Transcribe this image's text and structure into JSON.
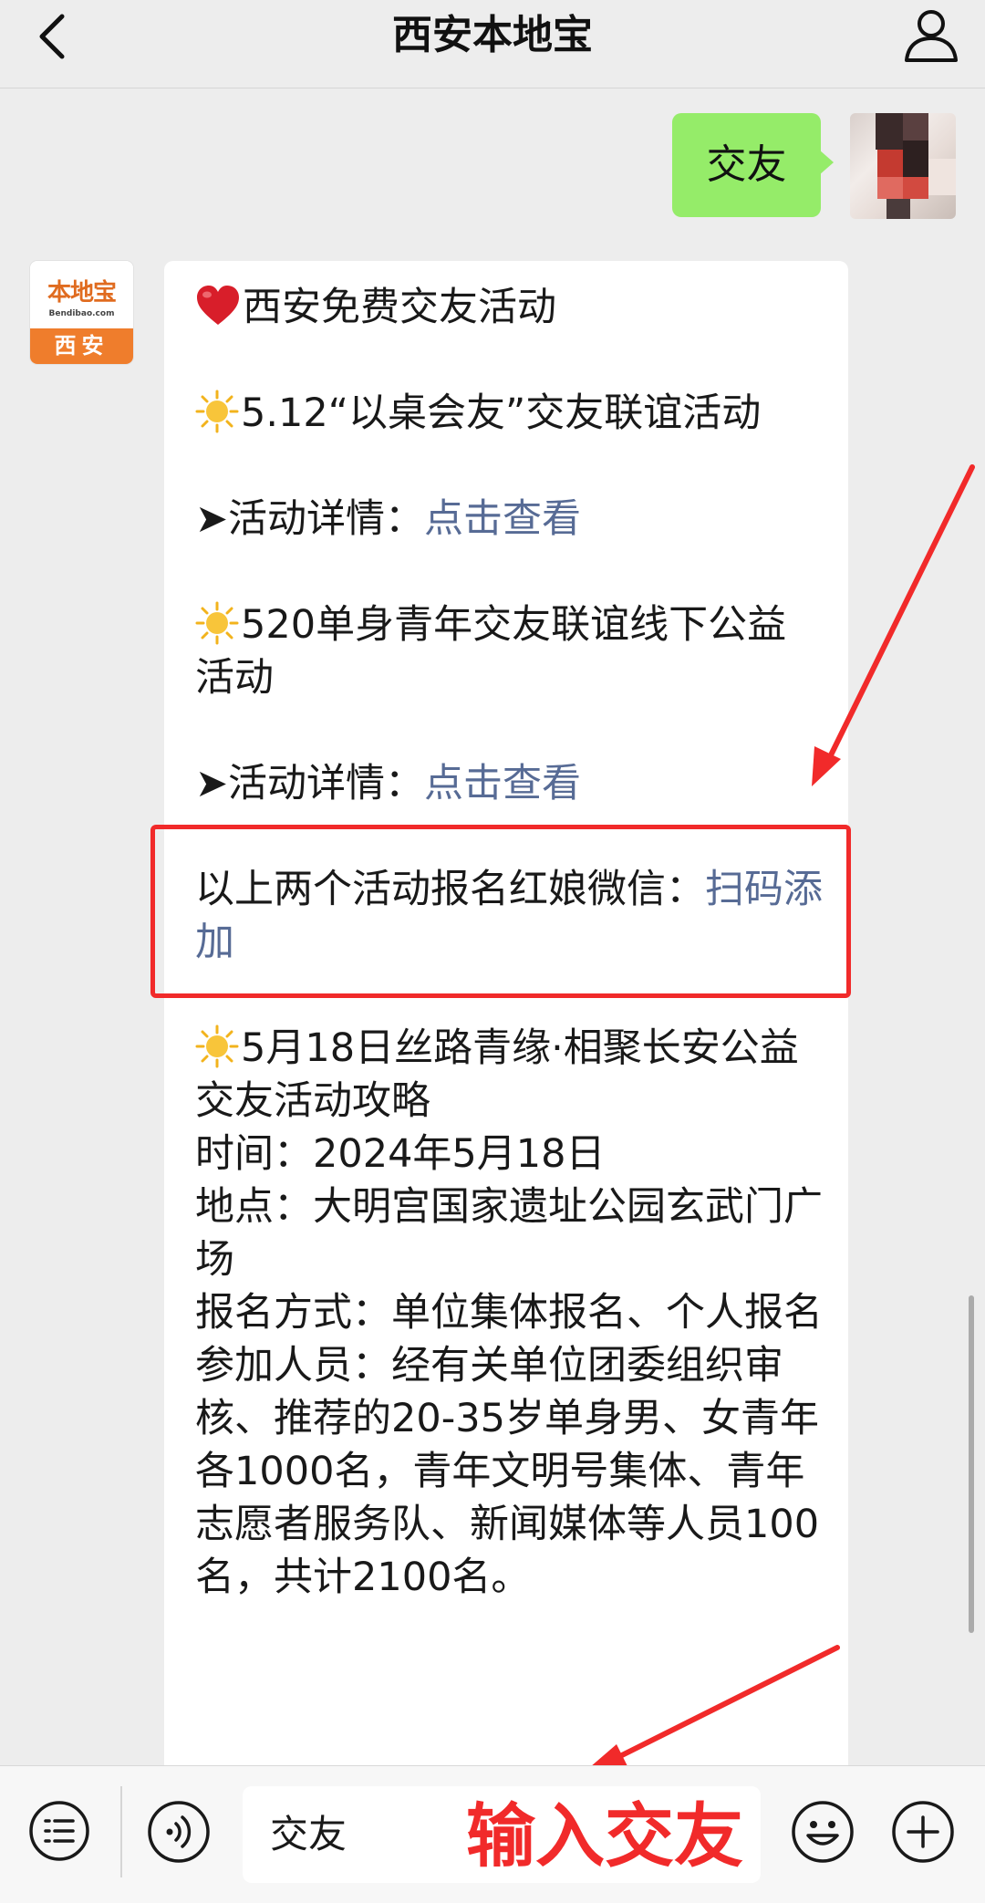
{
  "header": {
    "title": "西安本地宝"
  },
  "user_message": {
    "text": "交友"
  },
  "bot": {
    "avatar_logo": "本地宝",
    "avatar_domain": "Bendibao.com",
    "avatar_city": "西安"
  },
  "message": {
    "heading": "西安免费交友活动",
    "event1_title": "5.12“以桌会友”交友联谊活动",
    "event1_detail_label": "➤活动详情：",
    "event1_detail_link": "点击查看",
    "event2_title": "520单身青年交友联谊线下公益活动",
    "event2_detail_label": "➤活动详情：",
    "event2_detail_link": "点击查看",
    "signup_text": "以上两个活动报名红娘微信：",
    "signup_link": "扫码添加",
    "event3_title": "5月18日丝路青缘·相聚长安公益交友活动攻略",
    "event3_time": "时间：2024年5月18日",
    "event3_place": "地点：大明宫国家遗址公园玄武门广场",
    "event3_signup": "报名方式：单位集体报名、个人报名",
    "event3_people": "参加人员：经有关单位团委组织审核、推荐的20-35岁单身男、女青年各1000名，青年文明号集体、青年志愿者服务队、新闻媒体等人员100名，共计2100名。"
  },
  "input": {
    "value": "交友",
    "annotation": "输入交友"
  },
  "icons": {
    "back": "chevron-left-icon",
    "profile": "person-icon",
    "menu": "list-menu-icon",
    "voice": "voice-icon",
    "emoji": "emoji-icon",
    "plus": "plus-icon"
  },
  "colors": {
    "background": "#ededed",
    "user_bubble": "#95ec69",
    "link": "#576b95",
    "annotation": "#f12a2a",
    "brand_orange": "#ef7d2c"
  }
}
